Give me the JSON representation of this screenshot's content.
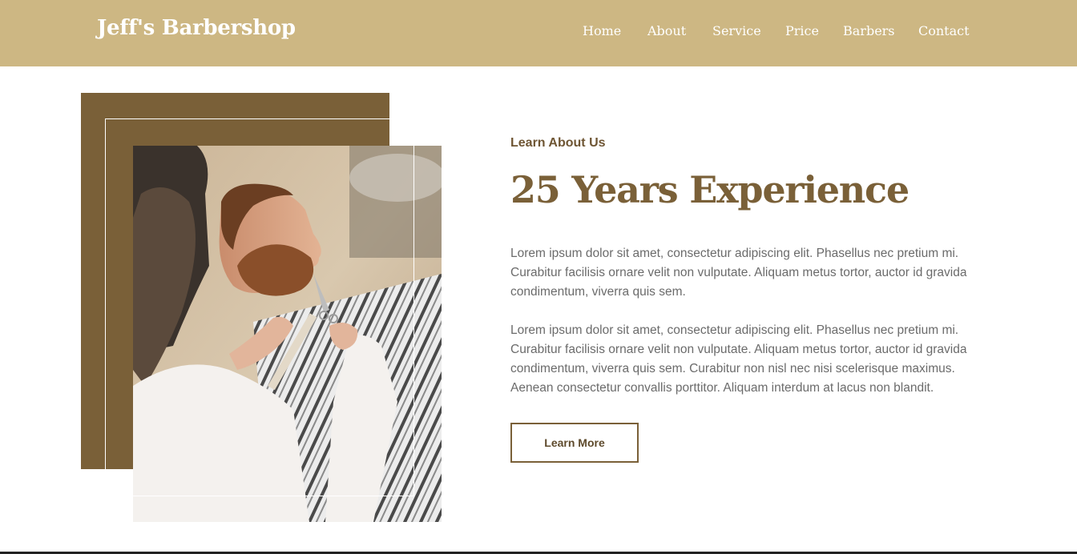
{
  "nav": {
    "brand": "Jeff's Barbershop",
    "links": [
      "Home",
      "About",
      "Service",
      "Price",
      "Barbers",
      "Contact"
    ]
  },
  "about": {
    "eyebrow": "Learn About Us",
    "headline": "25 Years Experience",
    "paragraph_1": "Lorem ipsum dolor sit amet, consectetur adipiscing elit. Phasellus nec pretium mi. Curabitur facilisis ornare velit non vulputate. Aliquam metus tortor, auctor id gravida condimentum, viverra quis sem.",
    "paragraph_2": "Lorem ipsum dolor sit amet, consectetur adipiscing elit. Phasellus nec pretium mi. Curabitur facilisis ornare velit non vulputate. Aliquam metus tortor, auctor id gravida condimentum, viverra quis sem. Curabitur non nisl nec nisi scelerisque maximus. Aenean consectetur convallis porttitor. Aliquam interdum at lacus non blandit.",
    "button_label": "Learn More"
  },
  "colors": {
    "navbar": "#cdb783",
    "accent_brown": "#7a6038",
    "text_gray": "#6b6b6b"
  }
}
